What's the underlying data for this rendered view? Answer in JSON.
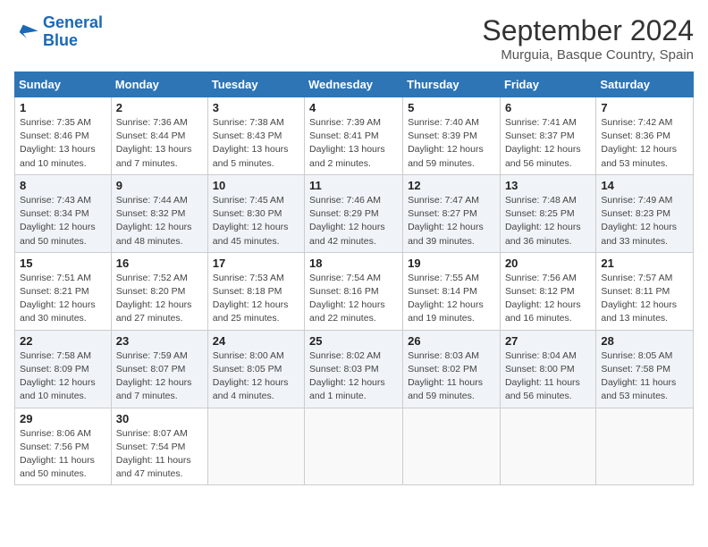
{
  "logo": {
    "line1": "General",
    "line2": "Blue"
  },
  "title": "September 2024",
  "subtitle": "Murguia, Basque Country, Spain",
  "weekdays": [
    "Sunday",
    "Monday",
    "Tuesday",
    "Wednesday",
    "Thursday",
    "Friday",
    "Saturday"
  ],
  "weeks": [
    [
      {
        "day": "1",
        "info": "Sunrise: 7:35 AM\nSunset: 8:46 PM\nDaylight: 13 hours\nand 10 minutes."
      },
      {
        "day": "2",
        "info": "Sunrise: 7:36 AM\nSunset: 8:44 PM\nDaylight: 13 hours\nand 7 minutes."
      },
      {
        "day": "3",
        "info": "Sunrise: 7:38 AM\nSunset: 8:43 PM\nDaylight: 13 hours\nand 5 minutes."
      },
      {
        "day": "4",
        "info": "Sunrise: 7:39 AM\nSunset: 8:41 PM\nDaylight: 13 hours\nand 2 minutes."
      },
      {
        "day": "5",
        "info": "Sunrise: 7:40 AM\nSunset: 8:39 PM\nDaylight: 12 hours\nand 59 minutes."
      },
      {
        "day": "6",
        "info": "Sunrise: 7:41 AM\nSunset: 8:37 PM\nDaylight: 12 hours\nand 56 minutes."
      },
      {
        "day": "7",
        "info": "Sunrise: 7:42 AM\nSunset: 8:36 PM\nDaylight: 12 hours\nand 53 minutes."
      }
    ],
    [
      {
        "day": "8",
        "info": "Sunrise: 7:43 AM\nSunset: 8:34 PM\nDaylight: 12 hours\nand 50 minutes."
      },
      {
        "day": "9",
        "info": "Sunrise: 7:44 AM\nSunset: 8:32 PM\nDaylight: 12 hours\nand 48 minutes."
      },
      {
        "day": "10",
        "info": "Sunrise: 7:45 AM\nSunset: 8:30 PM\nDaylight: 12 hours\nand 45 minutes."
      },
      {
        "day": "11",
        "info": "Sunrise: 7:46 AM\nSunset: 8:29 PM\nDaylight: 12 hours\nand 42 minutes."
      },
      {
        "day": "12",
        "info": "Sunrise: 7:47 AM\nSunset: 8:27 PM\nDaylight: 12 hours\nand 39 minutes."
      },
      {
        "day": "13",
        "info": "Sunrise: 7:48 AM\nSunset: 8:25 PM\nDaylight: 12 hours\nand 36 minutes."
      },
      {
        "day": "14",
        "info": "Sunrise: 7:49 AM\nSunset: 8:23 PM\nDaylight: 12 hours\nand 33 minutes."
      }
    ],
    [
      {
        "day": "15",
        "info": "Sunrise: 7:51 AM\nSunset: 8:21 PM\nDaylight: 12 hours\nand 30 minutes."
      },
      {
        "day": "16",
        "info": "Sunrise: 7:52 AM\nSunset: 8:20 PM\nDaylight: 12 hours\nand 27 minutes."
      },
      {
        "day": "17",
        "info": "Sunrise: 7:53 AM\nSunset: 8:18 PM\nDaylight: 12 hours\nand 25 minutes."
      },
      {
        "day": "18",
        "info": "Sunrise: 7:54 AM\nSunset: 8:16 PM\nDaylight: 12 hours\nand 22 minutes."
      },
      {
        "day": "19",
        "info": "Sunrise: 7:55 AM\nSunset: 8:14 PM\nDaylight: 12 hours\nand 19 minutes."
      },
      {
        "day": "20",
        "info": "Sunrise: 7:56 AM\nSunset: 8:12 PM\nDaylight: 12 hours\nand 16 minutes."
      },
      {
        "day": "21",
        "info": "Sunrise: 7:57 AM\nSunset: 8:11 PM\nDaylight: 12 hours\nand 13 minutes."
      }
    ],
    [
      {
        "day": "22",
        "info": "Sunrise: 7:58 AM\nSunset: 8:09 PM\nDaylight: 12 hours\nand 10 minutes."
      },
      {
        "day": "23",
        "info": "Sunrise: 7:59 AM\nSunset: 8:07 PM\nDaylight: 12 hours\nand 7 minutes."
      },
      {
        "day": "24",
        "info": "Sunrise: 8:00 AM\nSunset: 8:05 PM\nDaylight: 12 hours\nand 4 minutes."
      },
      {
        "day": "25",
        "info": "Sunrise: 8:02 AM\nSunset: 8:03 PM\nDaylight: 12 hours\nand 1 minute."
      },
      {
        "day": "26",
        "info": "Sunrise: 8:03 AM\nSunset: 8:02 PM\nDaylight: 11 hours\nand 59 minutes."
      },
      {
        "day": "27",
        "info": "Sunrise: 8:04 AM\nSunset: 8:00 PM\nDaylight: 11 hours\nand 56 minutes."
      },
      {
        "day": "28",
        "info": "Sunrise: 8:05 AM\nSunset: 7:58 PM\nDaylight: 11 hours\nand 53 minutes."
      }
    ],
    [
      {
        "day": "29",
        "info": "Sunrise: 8:06 AM\nSunset: 7:56 PM\nDaylight: 11 hours\nand 50 minutes."
      },
      {
        "day": "30",
        "info": "Sunrise: 8:07 AM\nSunset: 7:54 PM\nDaylight: 11 hours\nand 47 minutes."
      },
      {
        "day": "",
        "info": ""
      },
      {
        "day": "",
        "info": ""
      },
      {
        "day": "",
        "info": ""
      },
      {
        "day": "",
        "info": ""
      },
      {
        "day": "",
        "info": ""
      }
    ]
  ]
}
